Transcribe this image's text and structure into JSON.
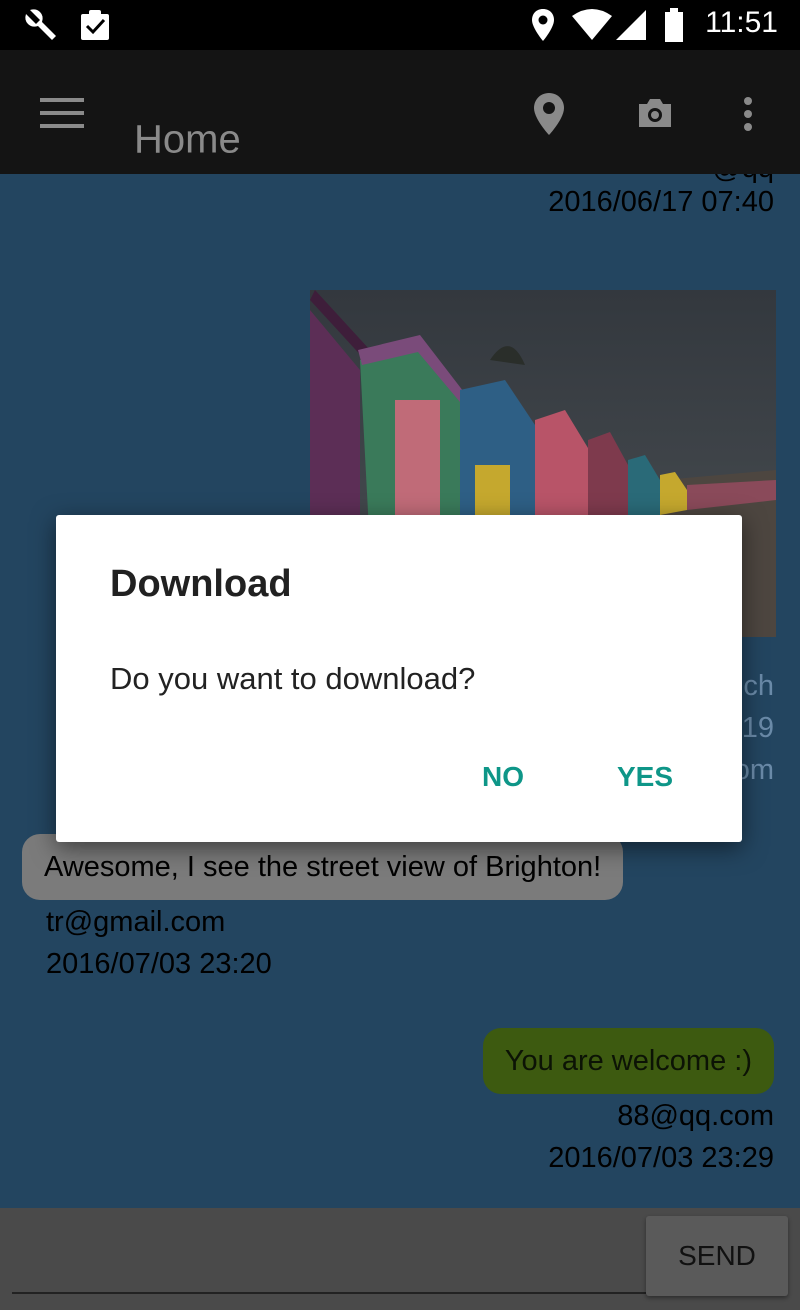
{
  "status_bar": {
    "time": "11:51",
    "icons": [
      "wrench-icon",
      "clipboard-check-icon",
      "location-icon",
      "wifi-icon",
      "signal-icon",
      "battery-icon"
    ]
  },
  "app_bar": {
    "title": "Home",
    "icons": [
      "menu-icon",
      "location-pin-icon",
      "camera-icon",
      "more-vert-icon"
    ]
  },
  "messages": [
    {
      "side": "right",
      "sender": "@qq",
      "timestamp": "2016/06/17 07:40"
    },
    {
      "side": "right",
      "type": "image",
      "partial_texts": [
        "ch",
        "19",
        "om"
      ]
    },
    {
      "side": "left",
      "text": "Awesome, I see the street view of Brighton!",
      "sender": "tr@gmail.com",
      "timestamp": "2016/07/03 23:20"
    },
    {
      "side": "right",
      "text": "You are welcome :)",
      "sender": "88@qq.com",
      "timestamp": "2016/07/03 23:29"
    }
  ],
  "compose": {
    "placeholder": "",
    "send_label": "SEND"
  },
  "dialog": {
    "title": "Download",
    "message": "Do you want to download?",
    "no_label": "NO",
    "yes_label": "YES",
    "accent_color": "#0e9688"
  },
  "colors": {
    "content_bg": "#234560",
    "left_bubble": "#7b7b7b",
    "right_bubble": "#3d5a10"
  }
}
